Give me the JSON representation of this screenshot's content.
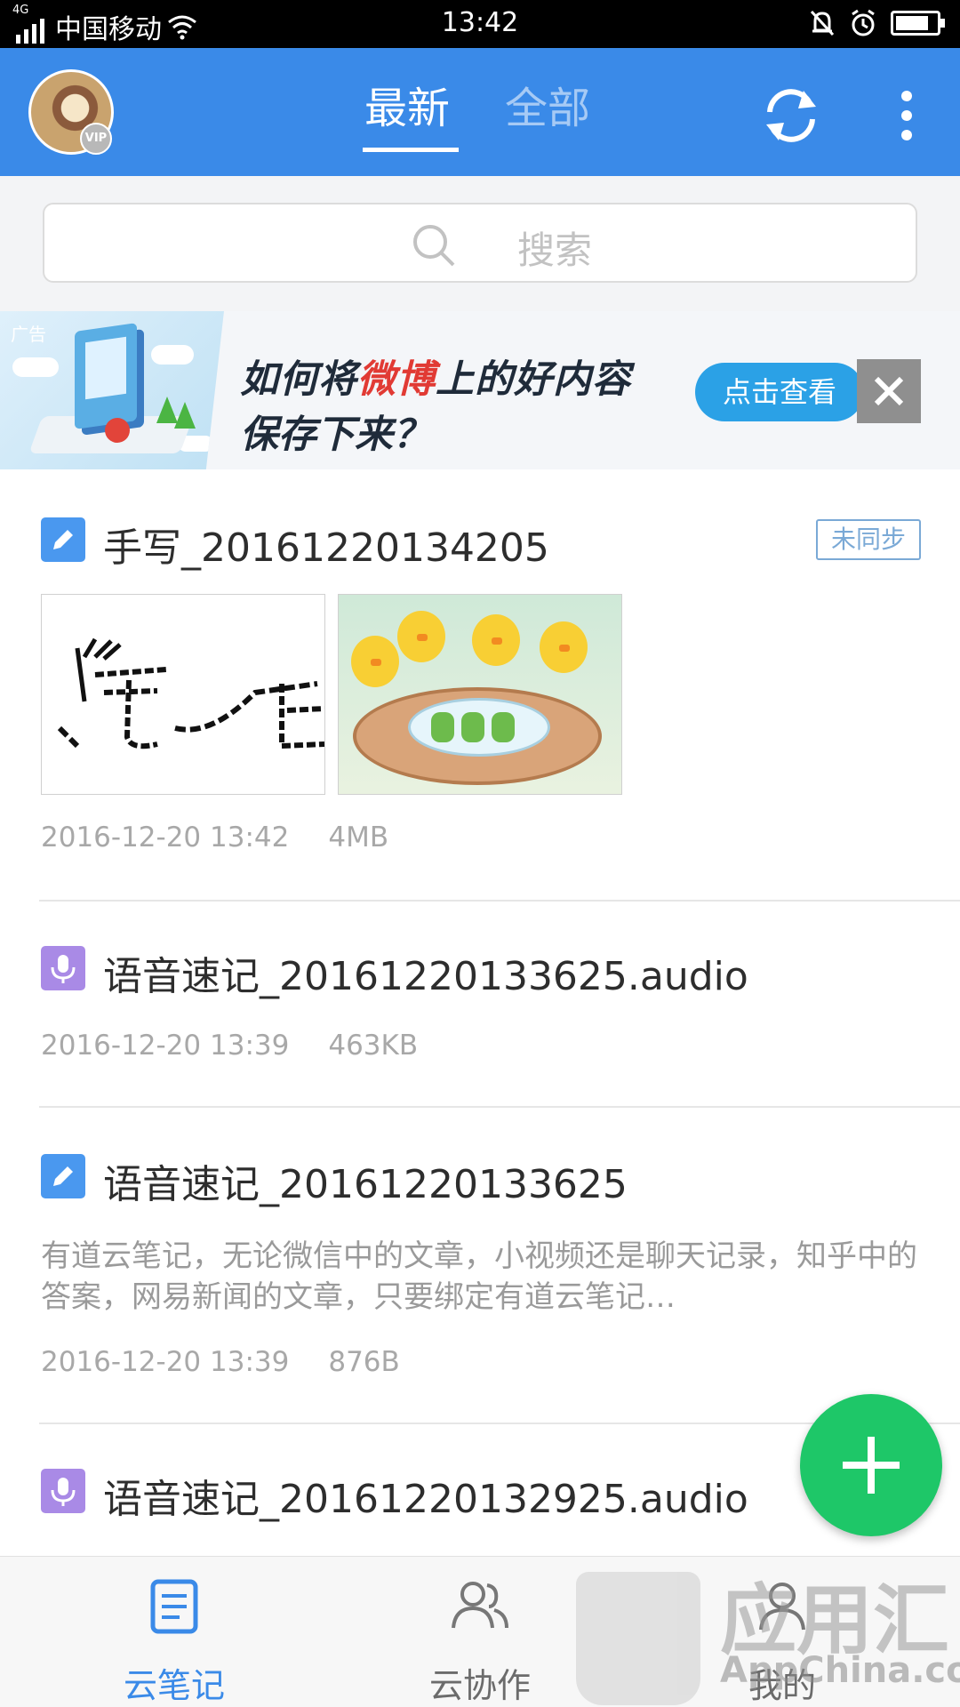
{
  "status_bar": {
    "network": "4G",
    "carrier": "中国移动",
    "time": "13:42"
  },
  "header": {
    "avatar_badge": "VIP",
    "tabs": [
      {
        "label": "最新",
        "active": true
      },
      {
        "label": "全部",
        "active": false
      }
    ],
    "sync_icon": "sync-icon",
    "more_icon": "more-vertical-icon",
    "background_color": "#3a8ae8"
  },
  "search": {
    "placeholder": "搜索",
    "icon": "search-icon"
  },
  "ad": {
    "tag": "广告",
    "headline_prefix": "如何将",
    "headline_highlight": "微博",
    "headline_suffix": "上的好内容",
    "headline_line2": "保存下来？",
    "cta_label": "点击查看",
    "close_icon": "close-icon"
  },
  "notes": [
    {
      "type": "handwriting",
      "icon": "pen-note-icon",
      "title": "手写_20161220134205",
      "sync_status": "未同步",
      "date": "2016-12-20 13:42",
      "size": "4MB",
      "thumbnails": [
        "handwriting-thumbnail",
        "chicks-photo-thumbnail"
      ]
    },
    {
      "type": "audio",
      "icon": "microphone-icon",
      "title": "语音速记_20161220133625.audio",
      "date": "2016-12-20 13:39",
      "size": "463KB"
    },
    {
      "type": "text",
      "icon": "pen-note-icon",
      "title": "语音速记_20161220133625",
      "summary": "有道云笔记，无论微信中的文章，小视频还是聊天记录，知乎中的答案，网易新闻的文章，只要绑定有道云笔记…",
      "date": "2016-12-20 13:39",
      "size": "876B"
    },
    {
      "type": "audio",
      "icon": "microphone-icon",
      "title": "语音速记_20161220132925.audio"
    }
  ],
  "fab": {
    "icon": "plus-icon",
    "color": "#1ec768"
  },
  "bottom_nav": {
    "items": [
      {
        "label": "云笔记",
        "icon": "note-document-icon",
        "active": true
      },
      {
        "label": "云协作",
        "icon": "people-icon",
        "active": false
      },
      {
        "label": "我的",
        "icon": "profile-icon",
        "active": false
      }
    ]
  },
  "watermark": {
    "text": "应用汇",
    "subtext": "AppChina.com"
  }
}
